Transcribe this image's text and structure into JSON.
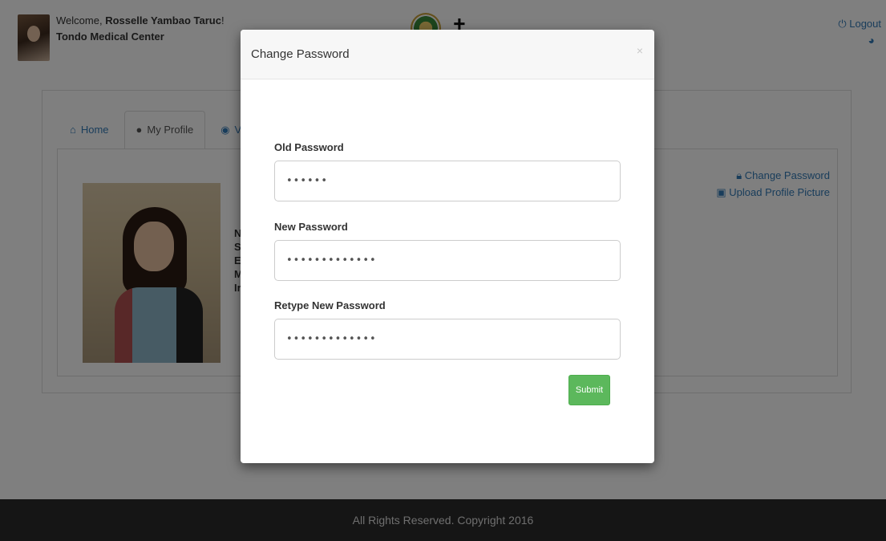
{
  "header": {
    "welcome_prefix": "Welcome,",
    "user_name": "Rosselle Yambao Taruc",
    "welcome_suffix": "!",
    "organization": "Tondo Medical Center",
    "logout_label": "Logout"
  },
  "tabs": [
    {
      "label": "Home",
      "icon": "home-icon"
    },
    {
      "label": "My Profile",
      "icon": "user-icon"
    },
    {
      "label": "Vie",
      "icon": "eye-icon"
    }
  ],
  "profile": {
    "field_initials": [
      "N",
      "S",
      "E",
      "M",
      "Ir"
    ],
    "change_password_link": "Change Password",
    "upload_picture_link": "Upload Profile Picture"
  },
  "modal": {
    "title": "Change Password",
    "close_symbol": "×",
    "fields": {
      "old_password": {
        "label": "Old Password",
        "value": "••••••"
      },
      "new_password": {
        "label": "New Password",
        "value": "•••••••••••••"
      },
      "retype_password": {
        "label": "Retype New Password",
        "value": "•••••••••••••"
      }
    },
    "submit_label": "Submit"
  },
  "footer": {
    "text": "All Rights Reserved. Copyright 2016"
  },
  "colors": {
    "link": "#337ab7",
    "submit": "#5cb85c",
    "footer_bg": "#2b2b2b"
  }
}
